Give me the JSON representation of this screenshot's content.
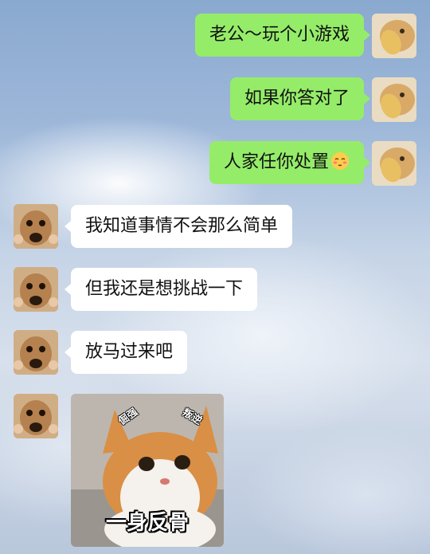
{
  "messages": [
    {
      "side": "right",
      "text": "老公～玩个小游戏"
    },
    {
      "side": "right",
      "text": "如果你答对了"
    },
    {
      "side": "right",
      "text": "人家任你处置",
      "emoji": "blushing-face-emoji"
    },
    {
      "side": "left",
      "text": "我知道事情不会那么简单"
    },
    {
      "side": "left",
      "text": "但我还是想挑战一下"
    },
    {
      "side": "left",
      "text": "放马过来吧"
    }
  ],
  "sticker": {
    "caption": "一身反骨",
    "ear_left": "倔强",
    "ear_right": "叛逆"
  },
  "colors": {
    "my_bubble": "#95ec69",
    "their_bubble": "#ffffff"
  }
}
